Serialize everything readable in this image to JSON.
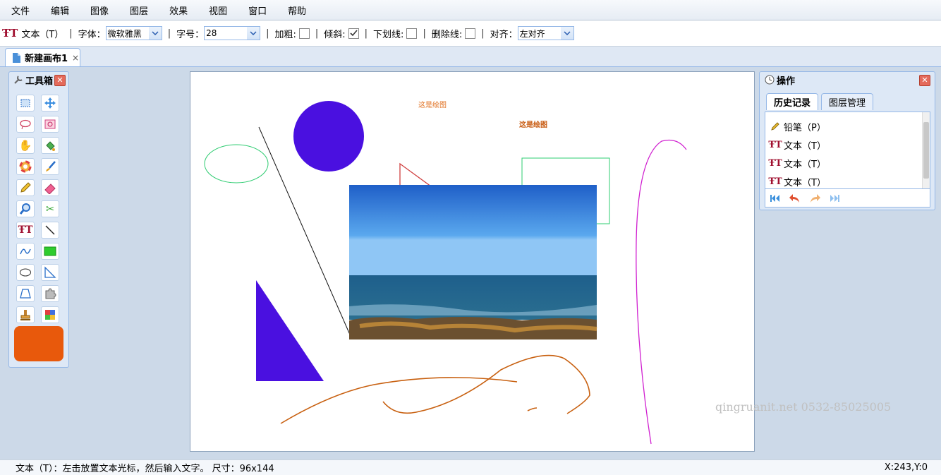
{
  "menu": [
    "文件",
    "编辑",
    "图像",
    "图层",
    "效果",
    "视图",
    "窗口",
    "帮助"
  ],
  "toolbar": {
    "tool_name": "文本（T）",
    "font_label": "字体：",
    "font_value": "微软雅黑",
    "size_label": "字号：",
    "size_value": "28",
    "bold_label": "加粗:",
    "bold_checked": false,
    "italic_label": "倾斜:",
    "italic_checked": true,
    "underline_label": "下划线:",
    "underline_checked": false,
    "strike_label": "删除线:",
    "strike_checked": false,
    "align_label": "对齐：",
    "align_value": "左对齐"
  },
  "document_tab": {
    "title": "新建画布1",
    "close": "×"
  },
  "toolbox": {
    "title": "工具箱",
    "tools": [
      "rect-select",
      "move",
      "lasso",
      "magic-select",
      "hand",
      "paint-bucket",
      "color-picker",
      "brush",
      "pencil",
      "eraser",
      "zoom",
      "scissors",
      "text",
      "line",
      "curve",
      "rectangle",
      "ellipse",
      "triangle",
      "polygon",
      "puzzle",
      "stamp",
      "palette"
    ],
    "current_color": "#e8590c"
  },
  "canvas": {
    "texts": [
      "这是绘图",
      "这是绘图"
    ]
  },
  "operations": {
    "title": "操作",
    "tabs": [
      "历史记录",
      "图层管理"
    ],
    "active_tab": 0,
    "history": [
      {
        "icon": "pencil-icon",
        "label": "铅笔（P）"
      },
      {
        "icon": "text-tool-icon",
        "label": "文本（T）"
      },
      {
        "icon": "text-tool-icon",
        "label": "文本（T）"
      },
      {
        "icon": "text-tool-icon",
        "label": "文本（T）"
      }
    ]
  },
  "watermark": "qingruanit.net 0532-85025005",
  "status": {
    "hint": "文本（T）：左击放置文本光标，然后输入文字。 尺寸：96x144",
    "coords": "X:243,Y:0"
  },
  "colors": {
    "accent_border": "#95b8e7",
    "brush_color": "#e8590c",
    "shape_purple": "#4a10e0"
  }
}
